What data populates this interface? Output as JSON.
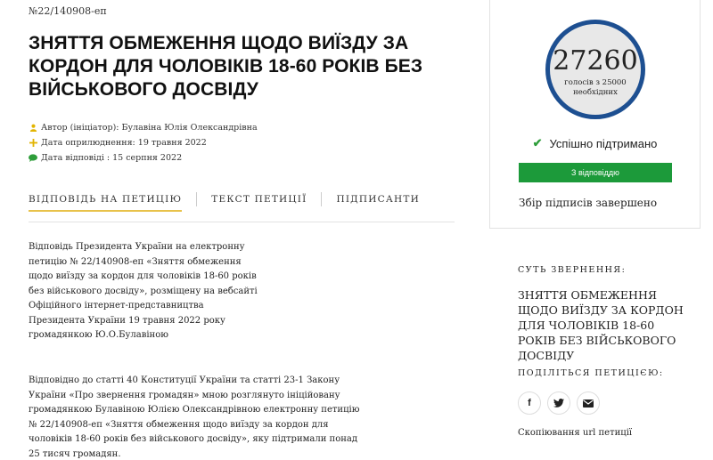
{
  "petition": {
    "number": "№22/140908-еп",
    "title": "ЗНЯТТЯ ОБМЕЖЕННЯ ЩОДО ВИЇЗДУ ЗА КОРДОН ДЛЯ ЧОЛОВІКІВ 18-60 РОКІВ БЕЗ ВІЙСЬКОВОГО ДОСВІДУ",
    "author": "Автор (ініціатор): Булавіна Юлія Олександрівна",
    "published": "Дата оприлюднення: 19 травня 2022",
    "answered": "Дата відповіді : 15 серпня 2022"
  },
  "tabs": [
    {
      "label": "ВІДПОВІДЬ НА ПЕТИЦІЮ",
      "active": true
    },
    {
      "label": "ТЕКСТ ПЕТИЦІЇ",
      "active": false
    },
    {
      "label": "ПІДПИСАНТИ",
      "active": false
    }
  ],
  "response": {
    "paragraph1": "Відповідь Президента України на електронну петицію № 22/140908-еп «Зняття обмеження щодо виїзду за кордон для чоловіків 18-60 років без військового досвіду», розміщену на вебсайті Офіційного інтернет-представництва Президента України 19 травня 2022 року громадянкою Ю.О.Булавіною",
    "paragraph2": "Відповідно до статті 40 Конституції України та статті 23-1 Закону України «Про звернення громадян» мною розглянуто ініційовану громадянкою Булавіною Юлією Олександрівною електронну петицію № 22/140908-еп «Зняття обмеження щодо виїзду за кордон для чоловіків 18-60 років без військового досвіду», яку підтримали понад 25 тисяч громадян."
  },
  "votes": {
    "count": "27260",
    "subtitle": "голосів з 25000 необхідних",
    "status": "Успішно підтримано",
    "answered_badge": "З відповіддю",
    "collection": "Збір підписів завершено"
  },
  "sidebar": {
    "essence_label": "СУТЬ ЗВЕРНЕННЯ:",
    "essence_text": "ЗНЯТТЯ ОБМЕЖЕННЯ ЩОДО ВИЇЗДУ ЗА КОРДОН ДЛЯ ЧОЛОВІКІВ 18-60 РОКІВ БЕЗ ВІЙСЬКОВОГО ДОСВІДУ",
    "share_label": "ПОДІЛІТЬСЯ ПЕТИЦІЄЮ:",
    "share_buttons": [
      {
        "icon": "facebook-icon",
        "glyph": "f"
      },
      {
        "icon": "twitter-icon",
        "glyph": "t"
      },
      {
        "icon": "email-icon",
        "glyph": "✉"
      }
    ],
    "copy_link": "Скопіювання url петиції"
  },
  "colors": {
    "accent_gold": "#e8c24a",
    "success_green": "#1c9a3a",
    "circle_blue": "#1d4f91"
  }
}
